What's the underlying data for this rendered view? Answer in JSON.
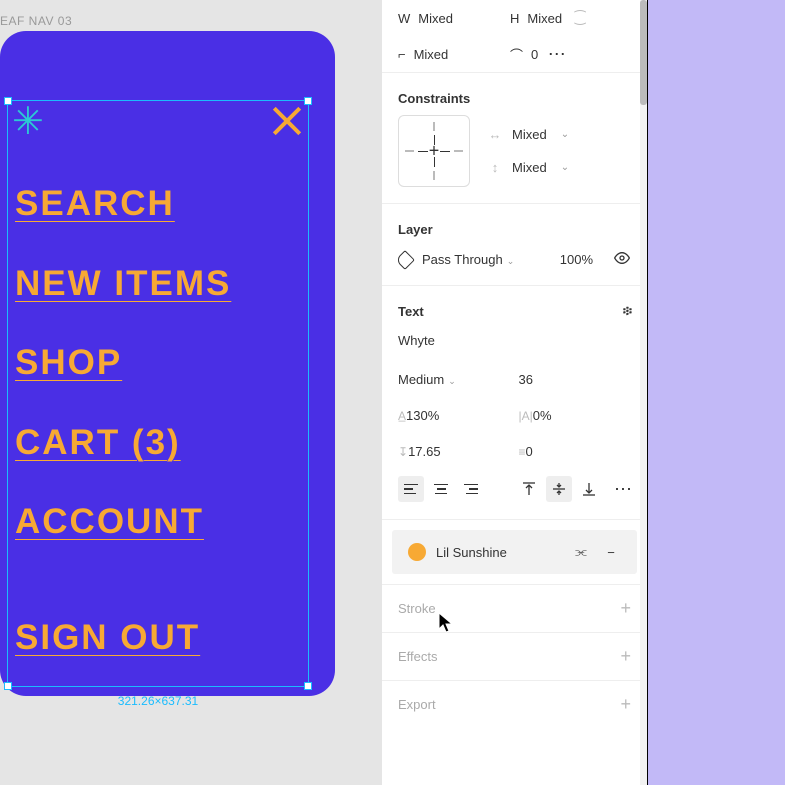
{
  "canvas": {
    "frame_label": "EAF NAV 03",
    "sparkle_glyph": "✳",
    "menu_items": [
      "SEARCH",
      "NEW ITEMS",
      "SHOP",
      "CART (3)",
      "ACCOUNT"
    ],
    "signout": "SIGN OUT",
    "selection_dim": "321.26×637.31"
  },
  "panel": {
    "dims": {
      "W_label": "W",
      "W": "Mixed",
      "H_label": "H",
      "H": "Mixed",
      "rot_lbl": "⌐",
      "rot": "Mixed",
      "rad_lbl": "⌒",
      "rad": "0",
      "link_glyph": "⁐",
      "more_glyph": "⋯"
    },
    "constraints": {
      "title": "Constraints",
      "h": {
        "icon": "↔",
        "val": "Mixed",
        "chev": "⌄"
      },
      "v": {
        "icon": "↕",
        "val": "Mixed",
        "chev": "⌄"
      }
    },
    "layer": {
      "title": "Layer",
      "blend": "Pass Through",
      "chev": "⌄",
      "opacity": "100%",
      "eye": "👁"
    },
    "text": {
      "title": "Text",
      "type_glyph": "፨",
      "font": "Whyte",
      "weight": "Medium",
      "weight_chev": "⌄",
      "size": "36",
      "line_lbl": "A̲",
      "line": "130%",
      "letter_lbl": "|A|",
      "letter": "0%",
      "para_lbl": "↧",
      "para": "17.65",
      "indent_lbl": "≡",
      "indent": "0",
      "more": "⋯"
    },
    "fill": {
      "name": "Lil Sunshine",
      "unlink": "⫘",
      "minus": "−"
    },
    "stroke": {
      "t": "Stroke",
      "plus": "+"
    },
    "effects": {
      "t": "Effects",
      "plus": "+"
    },
    "export": {
      "t": "Export",
      "plus": "+"
    }
  }
}
